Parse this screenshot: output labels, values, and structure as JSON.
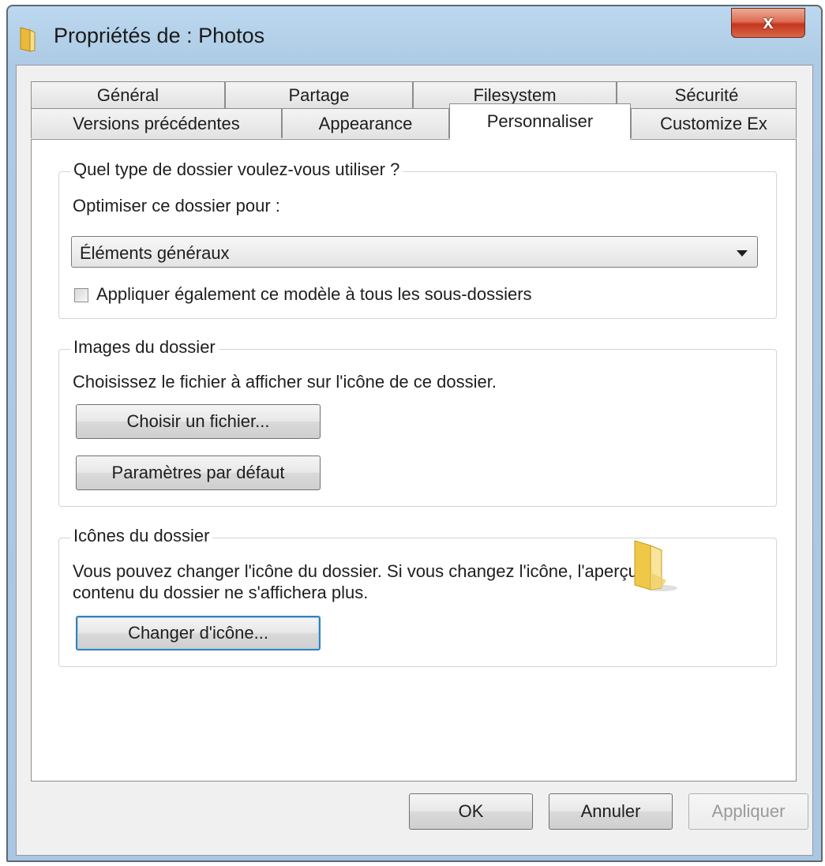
{
  "window": {
    "title": "Propriétés de : Photos",
    "close_label": "x",
    "icon": "folder-icon"
  },
  "tabs": {
    "row1": [
      {
        "label": "Général"
      },
      {
        "label": "Partage"
      },
      {
        "label": "Filesystem"
      },
      {
        "label": "Sécurité"
      }
    ],
    "row2": [
      {
        "label": "Versions précédentes"
      },
      {
        "label": "Appearance"
      },
      {
        "label": "Personnaliser",
        "active": true
      },
      {
        "label": "Customize Ex"
      }
    ]
  },
  "folder_type": {
    "legend": "Quel type de dossier voulez-vous utiliser ?",
    "optimize_label": "Optimiser ce dossier pour :",
    "optimize_value": "Éléments généraux",
    "apply_subfolders_label": "Appliquer également ce modèle à tous les sous-dossiers",
    "apply_subfolders_checked": false
  },
  "folder_images": {
    "legend": "Images du dossier",
    "description": "Choisissez le fichier à afficher sur l'icône de ce dossier.",
    "choose_file_label": "Choisir un fichier...",
    "restore_default_label": "Paramètres par défaut"
  },
  "folder_icons": {
    "legend": "Icônes du dossier",
    "description_line1": "Vous pouvez changer l'icône du dossier. Si vous changez l'icône, l'aperçu du",
    "description_line2": "contenu du dossier ne s'affichera plus.",
    "change_icon_label": "Changer d'icône...",
    "preview_icon": "folder-icon"
  },
  "footer": {
    "ok_label": "OK",
    "cancel_label": "Annuler",
    "apply_label": "Appliquer"
  },
  "colors": {
    "frame": "#aecbe5",
    "close_button": "#c4361e",
    "focus_border": "#3c7fb1",
    "folder_yellow": "#f2d36b"
  }
}
